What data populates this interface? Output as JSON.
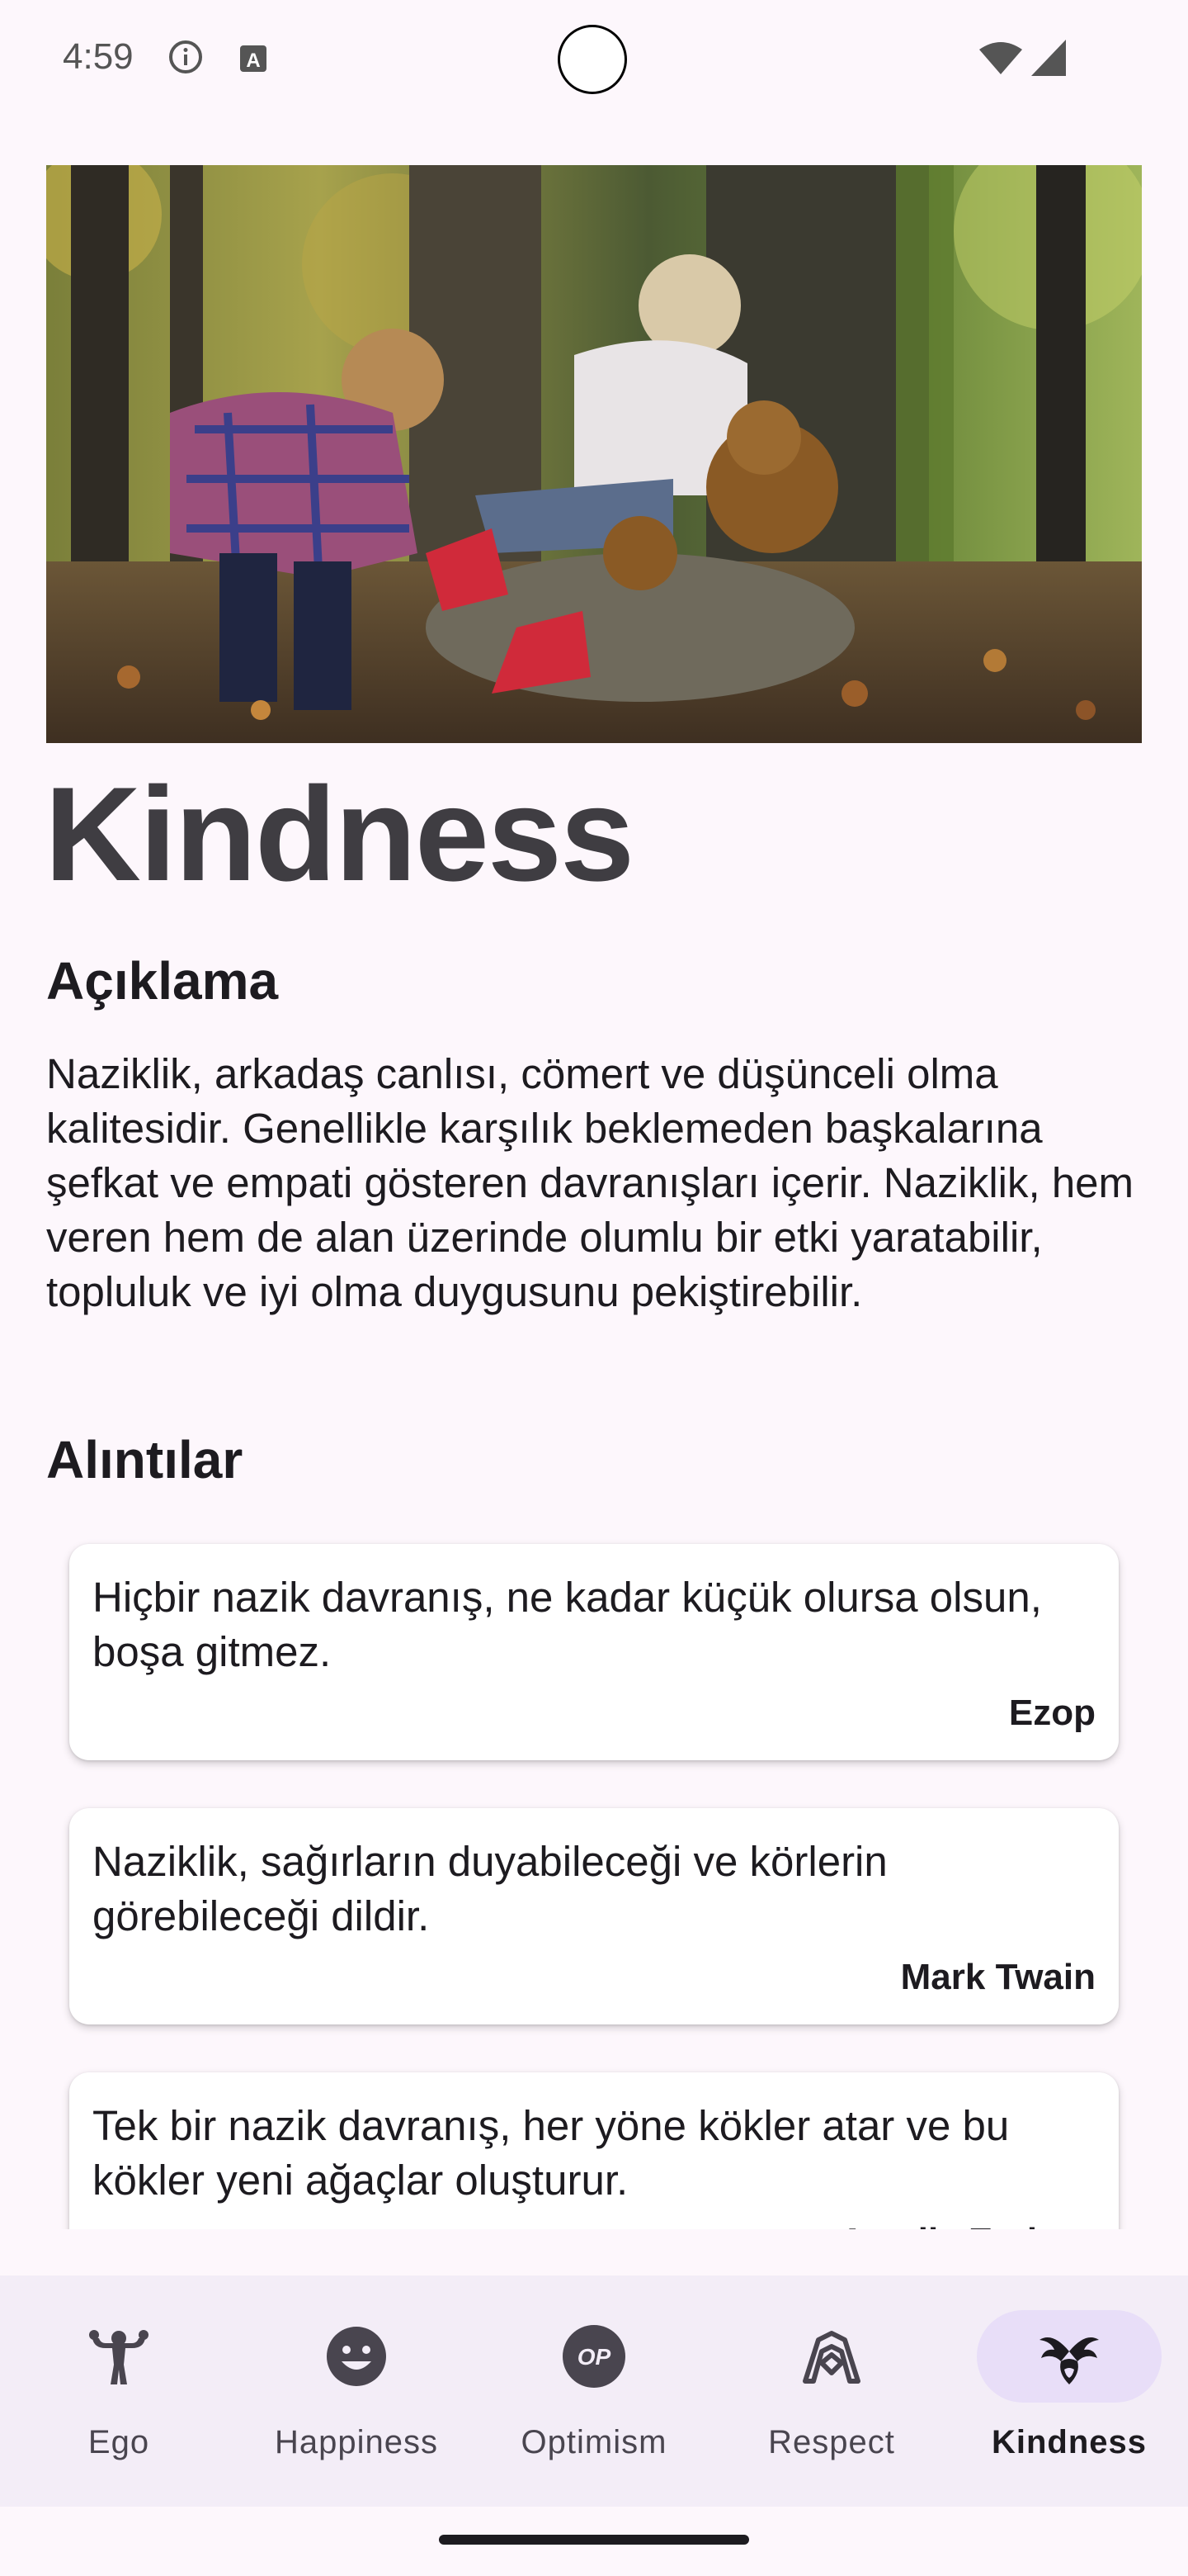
{
  "status_bar": {
    "time": "4:59",
    "icons": [
      "info-icon",
      "a-icon",
      "wifi-icon",
      "signal-icon"
    ]
  },
  "hero_image": {
    "alt": "Two children in an autumn forest, one helping the other with a red boot"
  },
  "page": {
    "title": "Kindness"
  },
  "description": {
    "heading": "Açıklama",
    "text": "Naziklik, arkadaş canlısı, cömert ve düşünceli olma kalitesidir. Genellikle karşılık beklemeden başkalarına şefkat ve empati gösteren davranışları içerir. Naziklik, hem veren hem de alan üzerinde olumlu bir etki yaratabilir, topluluk ve iyi olma duygusunu pekiştirebilir."
  },
  "quotes": {
    "heading": "Alıntılar",
    "items": [
      {
        "text": "Hiçbir nazik davranış, ne kadar küçük olursa olsun, boşa gitmez.",
        "author": "Ezop"
      },
      {
        "text": "Naziklik, sağırların duyabileceği ve körlerin görebileceği dildir.",
        "author": "Mark Twain"
      },
      {
        "text": "Tek bir nazik davranış, her yöne kökler atar ve bu kökler yeni ağaçlar oluşturur.",
        "author": "Amelia Earhart"
      }
    ]
  },
  "bottom_nav": {
    "active": "Kindness",
    "items": [
      {
        "label": "Ego",
        "icon": "strongman-icon"
      },
      {
        "label": "Happiness",
        "icon": "smiley-icon"
      },
      {
        "label": "Optimism",
        "icon": "op-badge-icon"
      },
      {
        "label": "Respect",
        "icon": "handshake-icon"
      },
      {
        "label": "Kindness",
        "icon": "kindness-icon"
      }
    ]
  },
  "colors": {
    "background": "#fdf7fc",
    "nav_background": "#f3edf7",
    "active_pill": "#e8def8",
    "title": "#3f3d42"
  }
}
